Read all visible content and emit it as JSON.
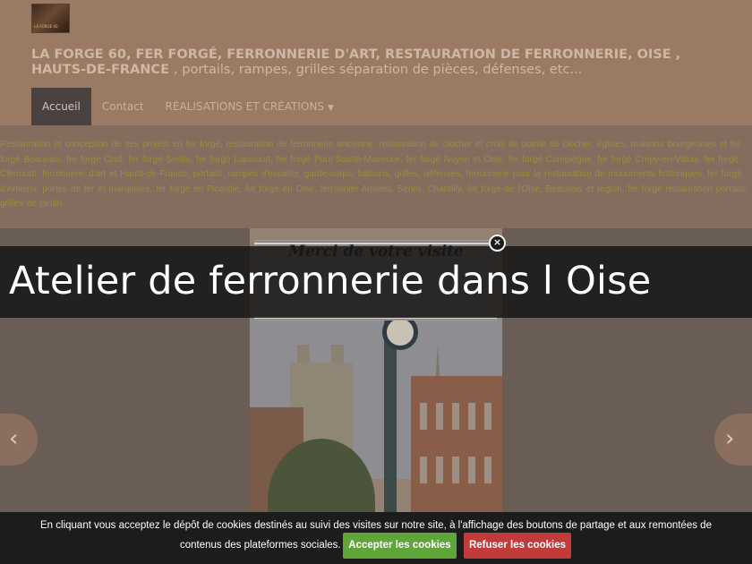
{
  "header": {
    "logo_text": "LA FORGE 60",
    "title": "LA FORGE 60, FER FORGÉ, FERRONNERIE D'ART, RESTAURATION DE FERRONNERIE, OISE , HAUTS-DE-FRANCE",
    "tagline": ", portails, rampes, grilles séparation de pièces, défenses, etc...",
    "nav": [
      {
        "label": "Accueil",
        "active": true
      },
      {
        "label": "Contact",
        "active": false
      },
      {
        "label": "RÉALISATIONS ET CRÉATIONS",
        "active": false,
        "has_dropdown": true
      }
    ]
  },
  "keywords": "Restauration et conception de ses projets en fer forgé, restauration de ferronnerie ancienne, restauration de clocher et croix de pointe de clocher, églises, maisons bourgeoises et fer forgé Beauvais, fer forgé Creil, fer forgé Senlis, fer forgé Liancourt, fer forgé Pont-Sainte-Maxence, fer forgé Noyon et Oise, fer forgé Compiègne, fer forgé Crépy-en-Valois, fer forgé Clermont, ferronnerie d'art et Hauts-de-France, portails, rampes d'escalier, garde-corps, balcons, grilles, défenses, ferronnerie pour la restauration de monuments historiques, fer forgé d'Amiens, portes de fer et marquises, fer forgé en Picardie, fer forgé en Oise, ferronnier Amiens, Senlis, Chantilly, fer forgé de l'Oise, Beauvais et région, fer forgé restauration portails, grilles de jardin",
  "slider": {
    "banner_text": "Merci de votre visite",
    "caption": "Atelier de ferronnerie dans l Oise",
    "prev_icon": "chevron-left-icon",
    "next_icon": "chevron-right-icon",
    "close_icon": "close-icon"
  },
  "cookie": {
    "line1": "En cliquant vous acceptez le dépôt de cookies destinés au suivi des visites sur notre site, à l'affichage des boutons de partage et aux remontées de",
    "line2": "contenus des plateformes sociales.",
    "accept_label": "Accepter les cookies",
    "refuse_label": "Refuser les cookies",
    "accept_color": "#5fa53a",
    "refuse_color": "#c23b3b"
  },
  "colors": {
    "header_bg": "#9b7a64",
    "overlay_caption_bg": "#141414",
    "cookie_bg": "#1c1c1c"
  }
}
